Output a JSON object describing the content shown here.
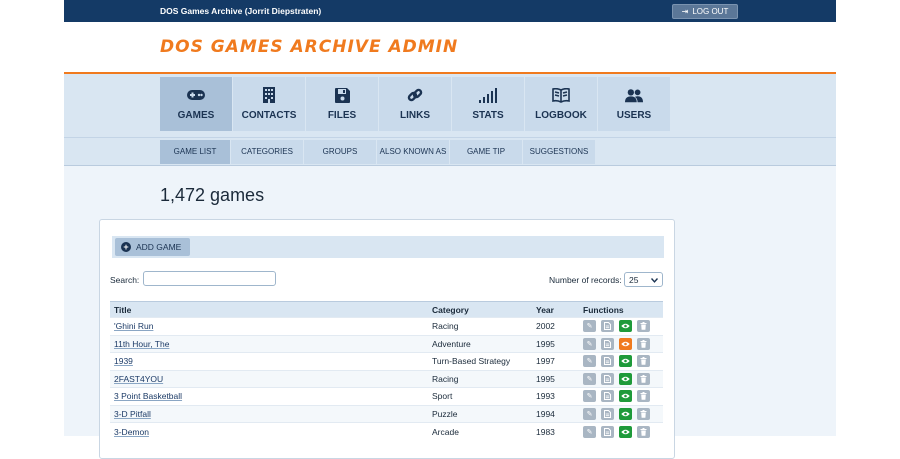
{
  "header": {
    "site_title": "DOS Games Archive (Jorrit Diepstraten)",
    "logout_label": "LOG OUT",
    "brand": "DOS GAMES ARCHIVE ADMIN"
  },
  "nav": {
    "items": [
      {
        "label": "GAMES",
        "icon": "gamepad-icon",
        "active": true
      },
      {
        "label": "CONTACTS",
        "icon": "building-icon",
        "active": false
      },
      {
        "label": "FILES",
        "icon": "floppy-disk-icon",
        "active": false
      },
      {
        "label": "LINKS",
        "icon": "link-icon",
        "active": false
      },
      {
        "label": "STATS",
        "icon": "signal-bars-icon",
        "active": false
      },
      {
        "label": "LOGBOOK",
        "icon": "book-icon",
        "active": false
      },
      {
        "label": "USERS",
        "icon": "users-icon",
        "active": false
      }
    ]
  },
  "subnav": {
    "items": [
      {
        "label": "GAME LIST",
        "active": true
      },
      {
        "label": "CATEGORIES",
        "active": false
      },
      {
        "label": "GROUPS",
        "active": false
      },
      {
        "label": "ALSO KNOWN AS",
        "active": false
      },
      {
        "label": "GAME TIP",
        "active": false
      },
      {
        "label": "SUGGESTIONS",
        "active": false
      }
    ]
  },
  "main": {
    "count_text": "1,472 games",
    "add_game_label": "ADD GAME",
    "search_label": "Search:",
    "search_value": "",
    "records_label": "Number of records:",
    "records_value": "25",
    "columns": [
      "Title",
      "Category",
      "Year",
      "Functions"
    ],
    "rows": [
      {
        "title": "'Ghini Run",
        "category": "Racing",
        "year": "2002",
        "view_status": "green"
      },
      {
        "title": "11th Hour, The",
        "category": "Adventure",
        "year": "1995",
        "view_status": "orange"
      },
      {
        "title": "1939",
        "category": "Turn-Based Strategy",
        "year": "1997",
        "view_status": "green"
      },
      {
        "title": "2FAST4YOU",
        "category": "Racing",
        "year": "1995",
        "view_status": "green"
      },
      {
        "title": "3 Point Basketball",
        "category": "Sport",
        "year": "1993",
        "view_status": "green"
      },
      {
        "title": "3-D Pitfall",
        "category": "Puzzle",
        "year": "1994",
        "view_status": "green"
      },
      {
        "title": "3-Demon",
        "category": "Arcade",
        "year": "1983",
        "view_status": "green"
      }
    ]
  },
  "colors": {
    "header_bg": "#143a66",
    "brand_orange": "#f07a1e",
    "nav_bg": "#c9daeb",
    "nav_active": "#a9c0d8",
    "view_green": "#1e9a3a",
    "view_orange": "#f07a1e"
  }
}
